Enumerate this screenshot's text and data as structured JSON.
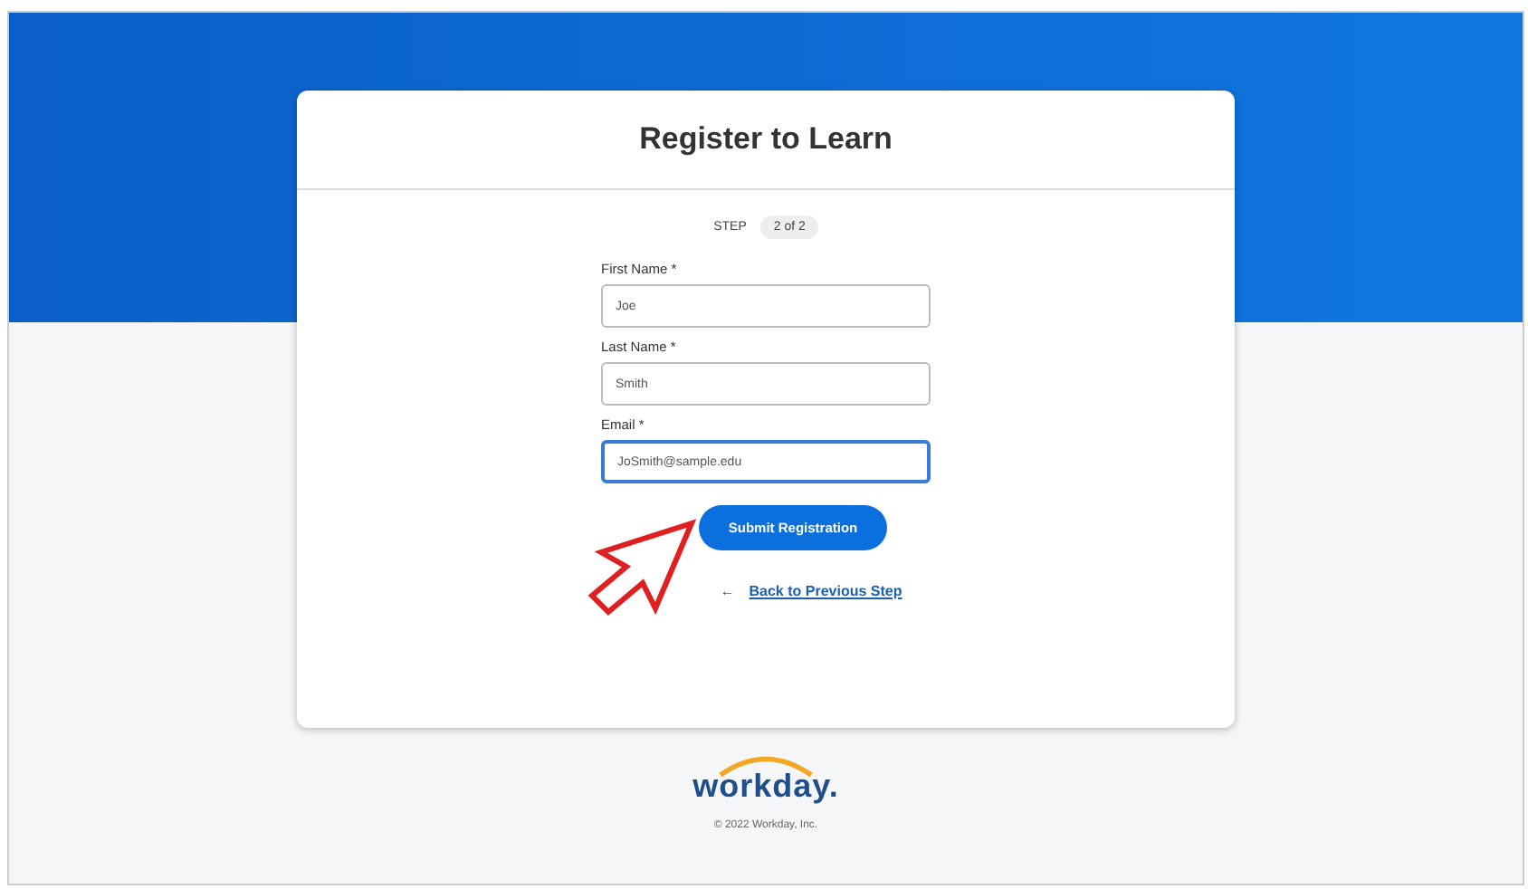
{
  "header": {
    "title": "Register to Learn"
  },
  "step": {
    "label": "STEP",
    "value": "2 of 2"
  },
  "fields": [
    {
      "label": "First Name *",
      "value": "Joe",
      "focused": false
    },
    {
      "label": "Last Name *",
      "value": "Smith",
      "focused": false
    },
    {
      "label": "Email *",
      "value": "JoSmith@sample.edu",
      "focused": true
    }
  ],
  "submit_button": "Submit Registration",
  "back_link": {
    "arrow": "←",
    "label": "Back to Previous Step"
  },
  "footer": {
    "logo": "workday.",
    "copyright": "© 2022 Workday, Inc."
  }
}
